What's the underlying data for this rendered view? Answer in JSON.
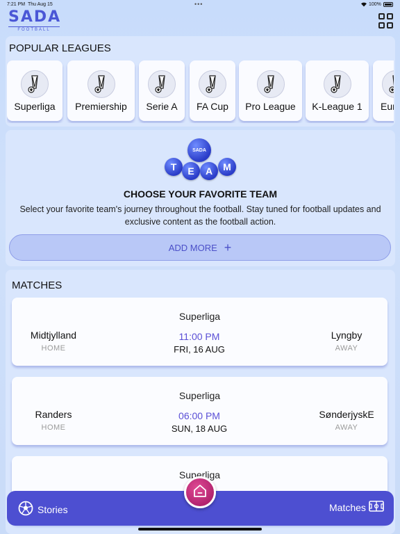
{
  "status_bar": {
    "time": "7:21 PM",
    "date": "Thu Aug 15",
    "battery": "100%"
  },
  "app": {
    "logo_text": "SADA",
    "logo_sub": "FOOTBALL"
  },
  "leagues": {
    "title": "POPULAR LEAGUES",
    "items": [
      {
        "label": "Superliga"
      },
      {
        "label": "Premiership"
      },
      {
        "label": "Serie A"
      },
      {
        "label": "FA Cup"
      },
      {
        "label": "Pro League"
      },
      {
        "label": "K-League 1"
      },
      {
        "label": "Euro"
      }
    ]
  },
  "team": {
    "logo_letters": [
      "T",
      "E",
      "A",
      "M"
    ],
    "logo_ball_text": "SADA",
    "heading": "CHOOSE YOUR FAVORITE TEAM",
    "description": "Select your favorite team's journey throughout the football. Stay tuned for football updates and exclusive content as the football action.",
    "add_more_label": "ADD MORE",
    "add_more_icon": "+"
  },
  "matches": {
    "title": "MATCHES",
    "items": [
      {
        "league": "Superliga",
        "home": "Midtjylland",
        "home_label": "HOME",
        "away": "Lyngby",
        "away_label": "AWAY",
        "time": "11:00 PM",
        "date": "FRI, 16 AUG"
      },
      {
        "league": "Superliga",
        "home": "Randers",
        "home_label": "HOME",
        "away": "SønderjyskE",
        "away_label": "AWAY",
        "time": "06:00 PM",
        "date": "SUN, 18 AUG"
      },
      {
        "league": "Superliga",
        "home": "",
        "home_label": "",
        "away": "",
        "away_label": "",
        "time": "",
        "date": ""
      }
    ]
  },
  "tabs": {
    "stories": "Stories",
    "matches": "Matches"
  },
  "colors": {
    "accent": "#4d4fd1",
    "home_button": "#c42c7c",
    "time": "#5a4fd6"
  }
}
